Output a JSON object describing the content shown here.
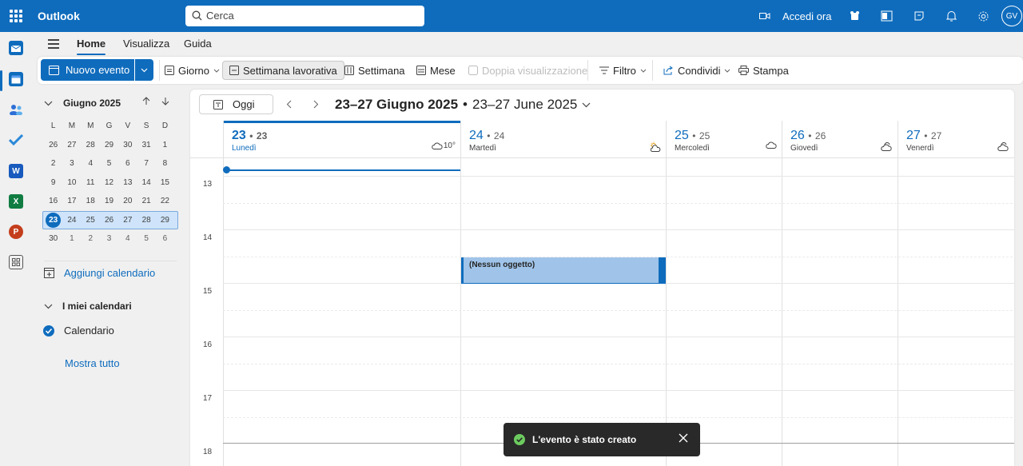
{
  "app": {
    "name": "Outlook",
    "user_initials": "GV"
  },
  "search": {
    "placeholder": "Cerca"
  },
  "topbar": {
    "meet_now": "Accedi ora"
  },
  "tabs": [
    "Home",
    "Visualizza",
    "Guida"
  ],
  "ribbon": {
    "new_event": "Nuovo evento",
    "day": "Giorno",
    "work_week": "Settimana lavorativa",
    "week": "Settimana",
    "month": "Mese",
    "split_view": "Doppia visualizzazione",
    "filter": "Filtro",
    "share": "Condividi",
    "print": "Stampa"
  },
  "mini_calendar": {
    "title": "Giugno 2025",
    "dow": [
      "L",
      "M",
      "M",
      "G",
      "V",
      "S",
      "D"
    ],
    "weeks": [
      [
        "26",
        "27",
        "28",
        "29",
        "30",
        "31",
        "1"
      ],
      [
        "2",
        "3",
        "4",
        "5",
        "6",
        "7",
        "8"
      ],
      [
        "9",
        "10",
        "11",
        "12",
        "13",
        "14",
        "15"
      ],
      [
        "16",
        "17",
        "18",
        "19",
        "20",
        "21",
        "22"
      ],
      [
        "23",
        "24",
        "25",
        "26",
        "27",
        "28",
        "29"
      ],
      [
        "30",
        "1",
        "2",
        "3",
        "4",
        "5",
        "6"
      ]
    ],
    "today": "23"
  },
  "sidebar": {
    "add_calendar": "Aggiungi calendario",
    "my_calendars": "I miei calendari",
    "calendar_name": "Calendario",
    "show_all": "Mostra tutto"
  },
  "calendar": {
    "today_button": "Oggi",
    "range_primary": "23–27 Giugno 2025",
    "range_separator": "•",
    "range_secondary": "23–27 June 2025",
    "days": [
      {
        "num": "23",
        "alt": "23",
        "name": "Lunedì",
        "weather": "10°"
      },
      {
        "num": "24",
        "alt": "24",
        "name": "Martedì",
        "weather": ""
      },
      {
        "num": "25",
        "alt": "25",
        "name": "Mercoledì",
        "weather": ""
      },
      {
        "num": "26",
        "alt": "26",
        "name": "Giovedì",
        "weather": ""
      },
      {
        "num": "27",
        "alt": "27",
        "name": "Venerdì",
        "weather": ""
      }
    ],
    "hours": [
      "13",
      "14",
      "15",
      "16",
      "17",
      "18"
    ],
    "event_title": "(Nessun oggetto)"
  },
  "toast": {
    "message": "L'evento è stato creato"
  },
  "colors": {
    "brand": "#0f6cbd",
    "event_fill": "#a0c4e9",
    "toast_bg": "#292929",
    "success": "#6ccb5f"
  }
}
